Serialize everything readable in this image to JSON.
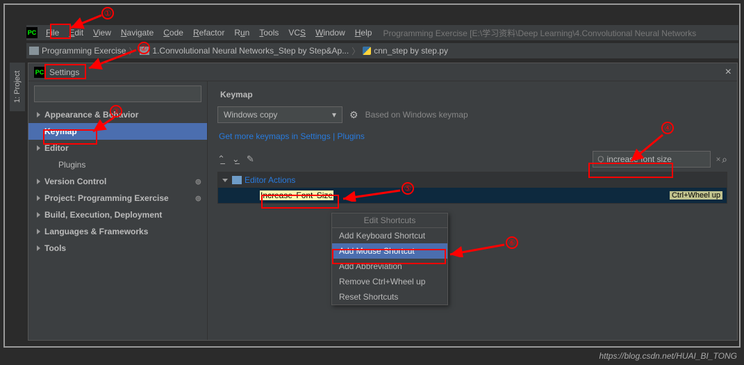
{
  "menubar": {
    "items": [
      "File",
      "Edit",
      "View",
      "Navigate",
      "Code",
      "Refactor",
      "Run",
      "Tools",
      "VCS",
      "Window",
      "Help"
    ],
    "title": "Programming Exercise [E:\\学习资料\\Deep Learning\\4.Convolutional Neural Networks"
  },
  "breadcrumb": {
    "root": "Programming Exercise",
    "folder": "1.Convolutional Neural Networks_Step by Step&Ap...",
    "file": "cnn_step by step.py"
  },
  "sidebar_tab": "1: Project",
  "dialog": {
    "title": "Settings",
    "close": "×",
    "search_ph": ""
  },
  "tree": {
    "items": [
      {
        "label": "Appearance & Behavior",
        "bold": true,
        "arrow": true
      },
      {
        "label": "Keymap",
        "bold": true,
        "sel": true
      },
      {
        "label": "Editor",
        "bold": true,
        "arrow": true
      },
      {
        "label": "Plugins",
        "indent": true
      },
      {
        "label": "Version Control",
        "bold": true,
        "arrow": true,
        "badge": "⊚"
      },
      {
        "label": "Project: Programming Exercise",
        "bold": true,
        "arrow": true,
        "badge": "⊚"
      },
      {
        "label": "Build, Execution, Deployment",
        "bold": true,
        "arrow": true
      },
      {
        "label": "Languages & Frameworks",
        "bold": true,
        "arrow": true
      },
      {
        "label": "Tools",
        "bold": true,
        "arrow": true
      }
    ]
  },
  "right": {
    "title": "Keymap",
    "combo": "Windows copy",
    "based": "Based on Windows keymap",
    "link": "Get more keymaps in Settings | Plugins",
    "search_value": "increase font size",
    "category": "Editor Actions",
    "action_parts": [
      "Increase",
      " Font ",
      "Size"
    ],
    "shortcut": "Ctrl+Wheel up"
  },
  "context": {
    "title": "Edit Shortcuts",
    "items": [
      "Add Keyboard Shortcut",
      "Add Mouse Shortcut",
      "Add Abbreviation",
      "Remove Ctrl+Wheel up",
      "Reset Shortcuts"
    ],
    "sel_index": 1
  },
  "watermark": "https://blog.csdn.net/HUAI_BI_TONG"
}
